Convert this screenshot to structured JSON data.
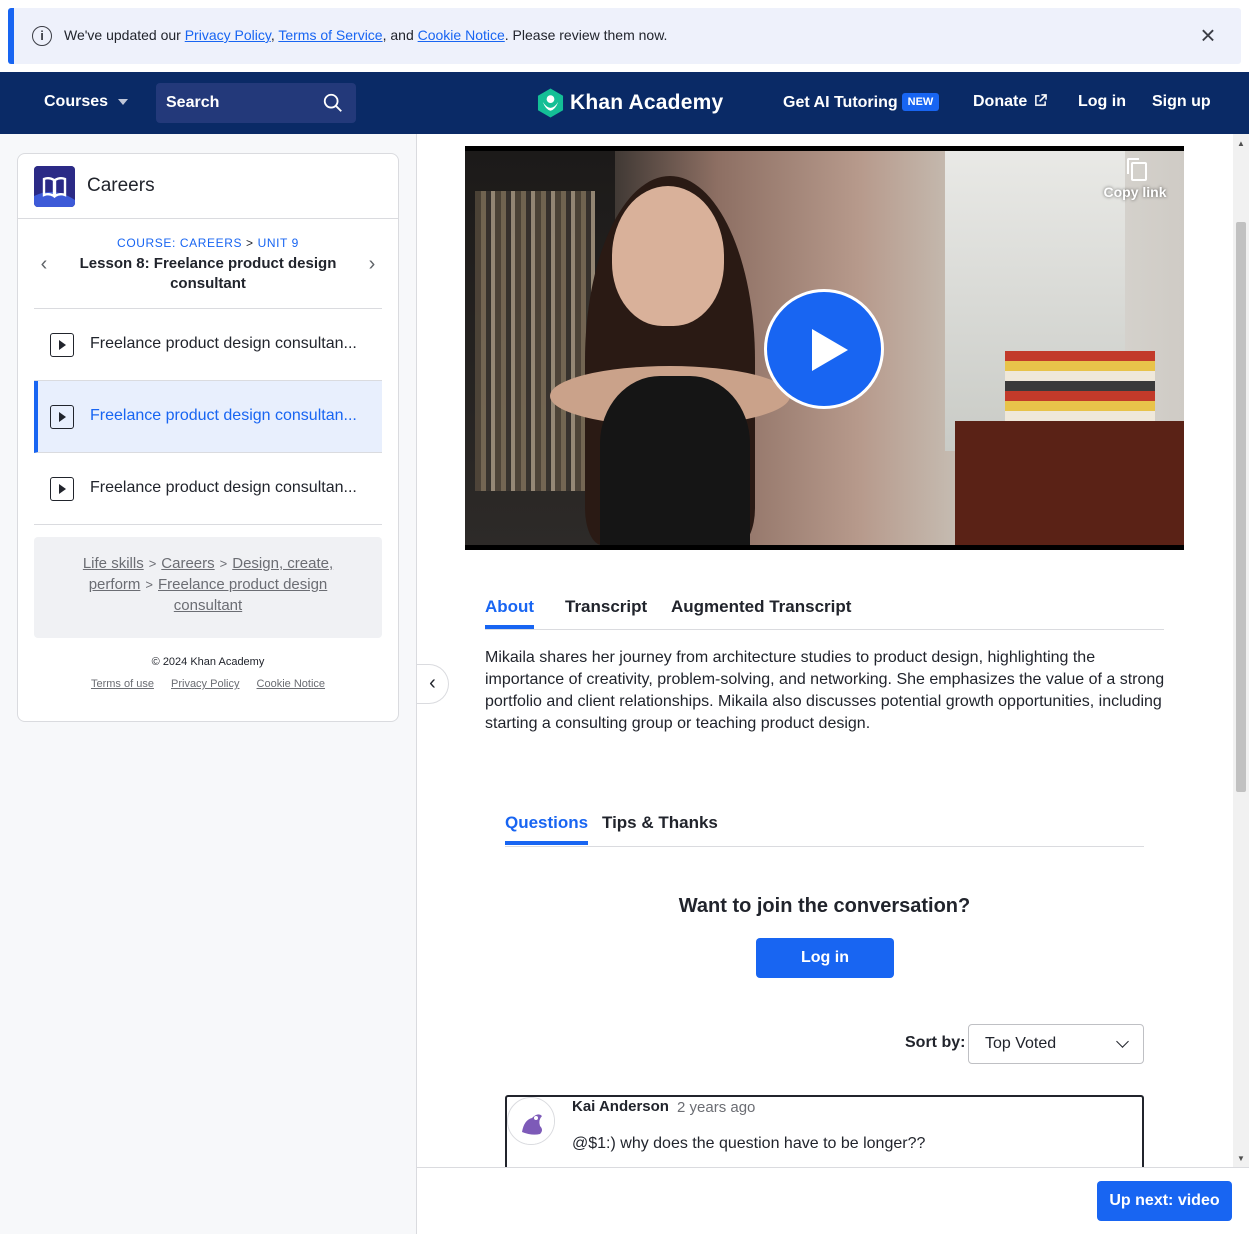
{
  "banner": {
    "prefix": "We've updated our",
    "privacy": "Privacy Policy",
    "comma": ",",
    "terms": "Terms of Service",
    "and": ", and",
    "cookie": "Cookie Notice",
    "suffix": ". Please review them now.",
    "close": "×"
  },
  "nav": {
    "courses": "Courses",
    "search_label": "Search",
    "brand": "Khan Academy",
    "ai_tutoring": "Get AI Tutoring",
    "new_badge": "NEW",
    "donate": "Donate",
    "login": "Log in",
    "signup": "Sign up"
  },
  "sidebar": {
    "course_title": "Careers",
    "crumb_course": "COURSE: CAREERS",
    "crumb_sep": ">",
    "crumb_unit": "UNIT 9",
    "lesson_title": "Lesson 8: Freelance product design consultant",
    "prev_arrow": "‹",
    "next_arrow": "›",
    "items": [
      {
        "label": "Freelance product design consultan..."
      },
      {
        "label": "Freelance product design consultan..."
      },
      {
        "label": "Freelance product design consultan..."
      }
    ],
    "breadcrumbs": {
      "life_skills": "Life skills",
      "careers": "Careers",
      "design": "Design, create, perform",
      "freelance": "Freelance product design consultant",
      "sep": ">"
    },
    "copyright": "© 2024 Khan Academy",
    "links": {
      "terms": "Terms of use",
      "privacy": "Privacy Policy",
      "cookie": "Cookie Notice"
    }
  },
  "collapse_arrow": "‹",
  "video": {
    "copy_link": "Copy link"
  },
  "content_tabs": [
    {
      "label": "About"
    },
    {
      "label": "Transcript"
    },
    {
      "label": "Augmented Transcript"
    }
  ],
  "description": "Mikaila shares her journey from architecture studies to product design, highlighting the importance of creativity, problem-solving, and networking. She emphasizes the value of a strong portfolio and client relationships. Mikaila also discusses potential growth opportunities, including starting a consulting group or teaching product design.",
  "discussion_tabs": [
    {
      "label": "Questions"
    },
    {
      "label": "Tips & Thanks"
    }
  ],
  "join": {
    "heading": "Want to join the conversation?",
    "button": "Log in"
  },
  "sort": {
    "label": "Sort by:",
    "value": "Top Voted"
  },
  "comment": {
    "author": "Kai Anderson",
    "time": "2 years ago",
    "text": "@$1:) why does the question have to be longer??"
  },
  "up_next": "Up next: video",
  "colors": {
    "accent": "#1865f2",
    "nav_bg": "#0a2a66",
    "banner_bg": "#eef1fb",
    "active_item_bg": "#e8effd"
  }
}
